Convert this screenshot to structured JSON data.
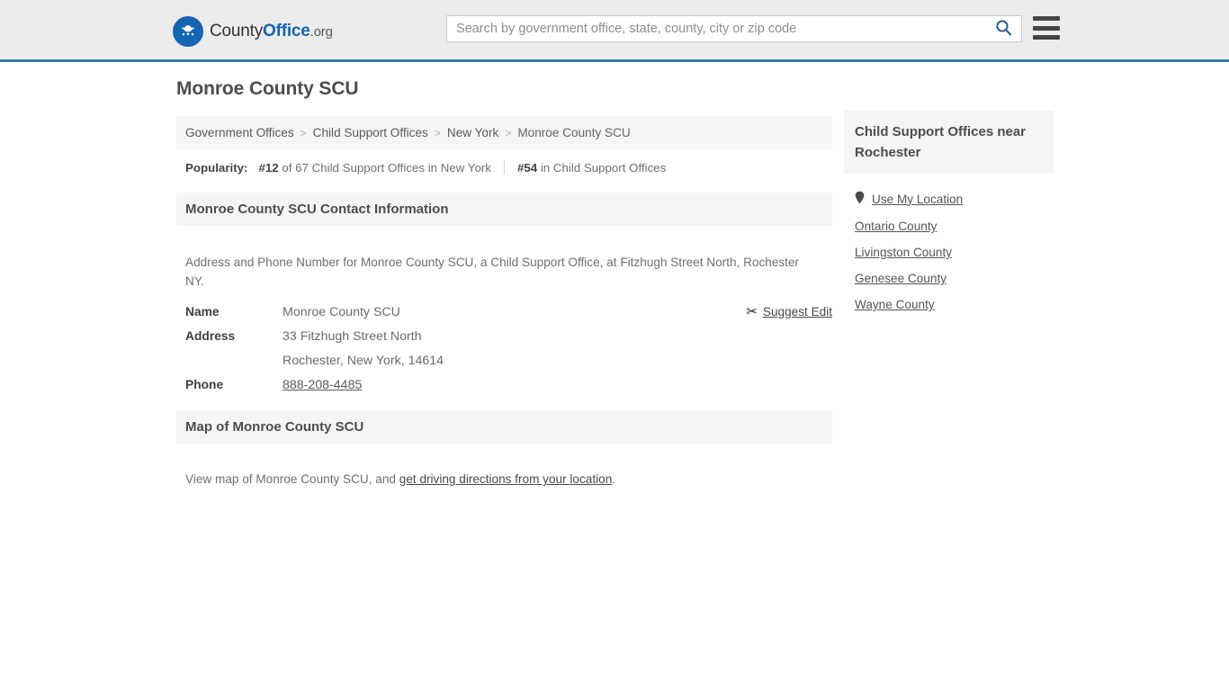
{
  "header": {
    "logo": {
      "icon": "eagle-seal-icon",
      "text_county": "County",
      "text_office": "Office",
      "text_org": ".org"
    },
    "search": {
      "placeholder": "Search by government office, state, county, city or zip code",
      "value": "",
      "icon": "search-icon"
    },
    "menu": {
      "icon": "hamburger-menu-icon",
      "label": "Menu"
    }
  },
  "main": {
    "page_title": "Monroe County SCU",
    "breadcrumb": {
      "items": [
        {
          "label": "Government Offices"
        },
        {
          "label": "Child Support Offices"
        },
        {
          "label": "New York"
        },
        {
          "label": "Monroe County SCU"
        }
      ],
      "separator": ">"
    },
    "popularity": {
      "label": "Popularity:",
      "stat1_rank": "#12",
      "stat1_text": "of 67 Child Support Offices in New York",
      "stat2_rank": "#54",
      "stat2_text": "in Child Support Offices"
    },
    "contact": {
      "section_title": "Monroe County SCU Contact Information",
      "description": "Address and Phone Number for Monroe County SCU, a Child Support Office, at Fitzhugh Street North, Rochester NY.",
      "suggest_edit": {
        "label": "Suggest Edit",
        "icon": "edit-icon",
        "glyph": "✂"
      },
      "rows": [
        {
          "label": "Name",
          "value": "Monroe County SCU",
          "link": false
        },
        {
          "label": "Address",
          "value": "33 Fitzhugh Street North",
          "link": false
        },
        {
          "label": "",
          "value": "Rochester, New York, 14614",
          "link": false
        },
        {
          "label": "Phone",
          "value": "888-208-4485",
          "link": true
        }
      ]
    },
    "map": {
      "section_title": "Map of Monroe County SCU",
      "desc_prefix": "View map of Monroe County SCU, and ",
      "desc_link": "get driving directions from your location",
      "desc_suffix": "."
    }
  },
  "sidebar": {
    "title": "Child Support Offices near Rochester",
    "links": [
      {
        "label": "Use My Location",
        "icon": "map-pin-icon"
      },
      {
        "label": "Ontario County",
        "icon": ""
      },
      {
        "label": "Livingston County",
        "icon": ""
      },
      {
        "label": "Genesee County",
        "icon": ""
      },
      {
        "label": "Wayne County",
        "icon": ""
      }
    ]
  },
  "colors": {
    "header_bg": "#ececec",
    "header_border": "#3b76a8",
    "brand_blue": "#1464b4",
    "panel_bg": "#f5f5f5",
    "text_dark": "#4d4d4d",
    "text_muted": "#6f6f6f"
  }
}
